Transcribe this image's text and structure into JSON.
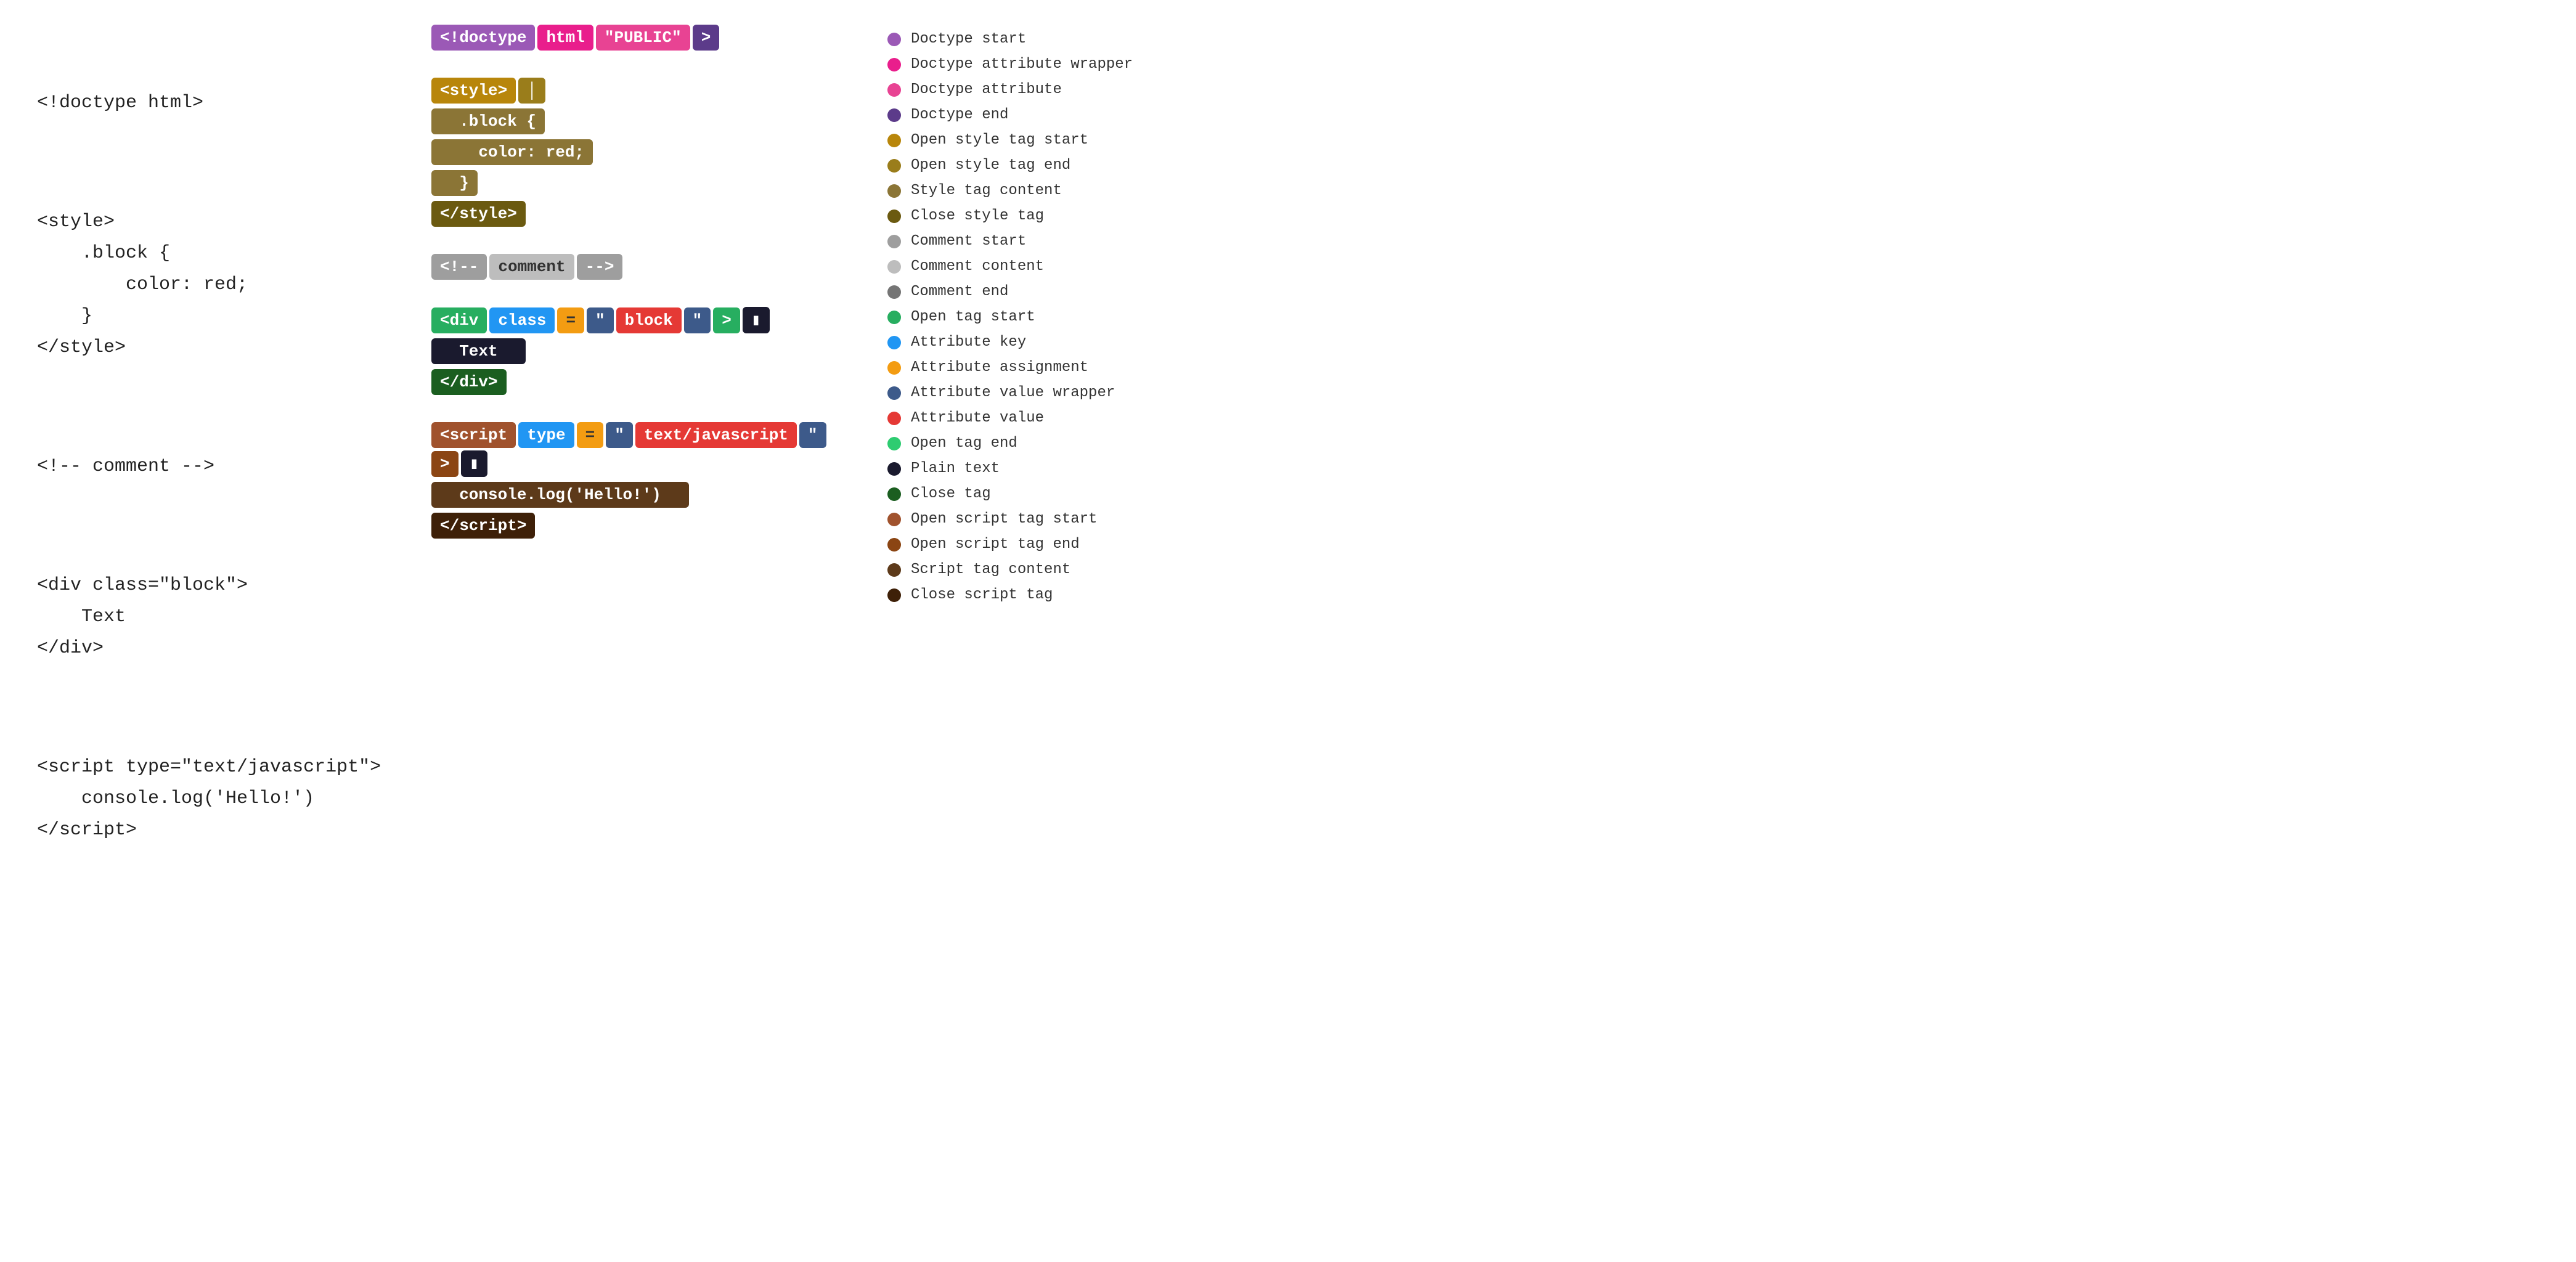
{
  "left": {
    "blocks": [
      "<!doctype html>",
      "<style>\n    .block {\n        color: red;\n    }\n</style>",
      "<!-- comment -->",
      "<div class=\"block\">\n    Text\n</div>",
      "<script type=\"text/javascript\">\n    console.log('Hello!')\n</script>"
    ]
  },
  "legend": {
    "items": [
      {
        "dot": "dot-doctype-start",
        "label": "Doctype start"
      },
      {
        "dot": "dot-doctype-attr-wrap",
        "label": "Doctype attribute wrapper"
      },
      {
        "dot": "dot-doctype-attr",
        "label": "Doctype attribute"
      },
      {
        "dot": "dot-doctype-end",
        "label": "Doctype end"
      },
      {
        "dot": "dot-open-style-start",
        "label": "Open style tag start"
      },
      {
        "dot": "dot-open-style-end",
        "label": "Open style tag end"
      },
      {
        "dot": "dot-style-content",
        "label": "Style tag content"
      },
      {
        "dot": "dot-close-style",
        "label": "Close style tag"
      },
      {
        "dot": "dot-comment-start",
        "label": "Comment start"
      },
      {
        "dot": "dot-comment-content",
        "label": "Comment content"
      },
      {
        "dot": "dot-comment-end",
        "label": "Comment end"
      },
      {
        "dot": "dot-open-tag-start",
        "label": "Open tag start"
      },
      {
        "dot": "dot-attr-key",
        "label": "Attribute key"
      },
      {
        "dot": "dot-attr-assign",
        "label": "Attribute assignment"
      },
      {
        "dot": "dot-attr-val-wrap",
        "label": "Attribute value wrapper"
      },
      {
        "dot": "dot-attr-val",
        "label": "Attribute value"
      },
      {
        "dot": "dot-open-tag-end",
        "label": "Open tag end"
      },
      {
        "dot": "dot-plain-text",
        "label": "Plain text"
      },
      {
        "dot": "dot-close-tag",
        "label": "Close tag"
      },
      {
        "dot": "dot-open-script-start",
        "label": "Open script tag start"
      },
      {
        "dot": "dot-open-script-end",
        "label": "Open script tag end"
      },
      {
        "dot": "dot-script-content",
        "label": "Script tag content"
      },
      {
        "dot": "dot-close-script",
        "label": "Close script tag"
      }
    ]
  }
}
